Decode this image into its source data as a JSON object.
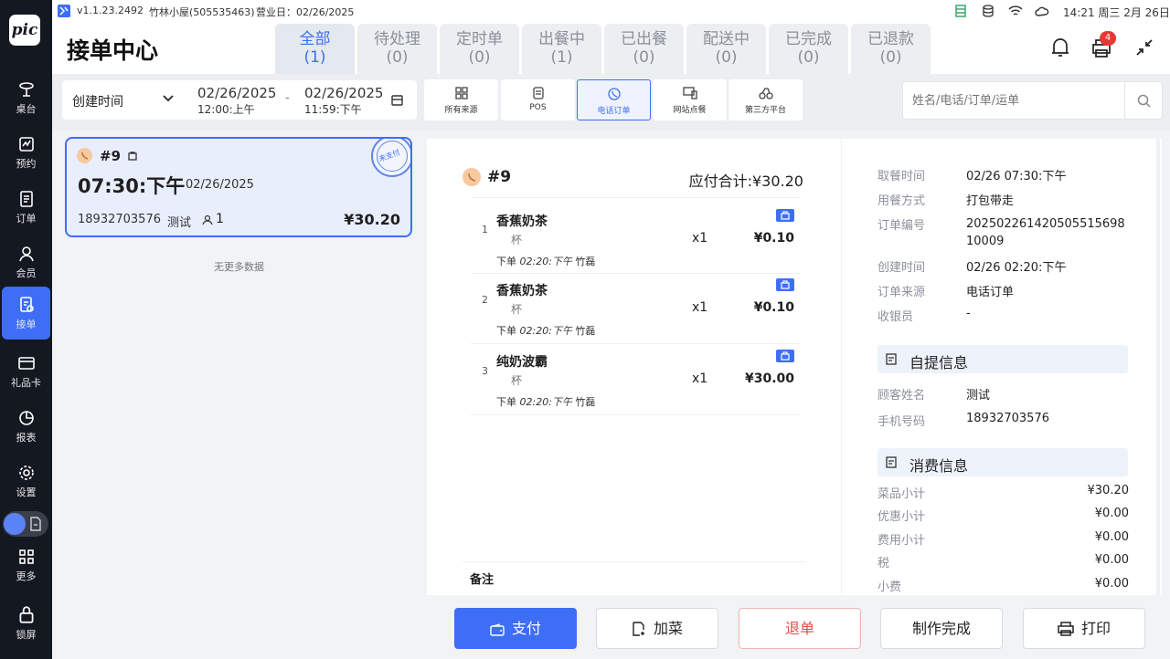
{
  "status": {
    "version": "v1.1.23.2492",
    "store": "竹林小屋(505535463)",
    "business_day": "营业日：02/26/2025",
    "clock": "14:21 周三 2月 26日"
  },
  "sidebar": {
    "logo": "pic",
    "items": [
      {
        "label": "桌台",
        "icon": "table-bell-icon"
      },
      {
        "label": "预约",
        "icon": "calendar-check-icon"
      },
      {
        "label": "订单",
        "icon": "order-list-icon"
      },
      {
        "label": "会员",
        "icon": "user-icon"
      },
      {
        "label": "接单",
        "icon": "receive-order-icon"
      },
      {
        "label": "礼品卡",
        "icon": "gift-card-icon"
      },
      {
        "label": "报表",
        "icon": "pie-chart-icon"
      },
      {
        "label": "设置",
        "icon": "gear-icon"
      },
      {
        "label": "更多",
        "icon": "grid-icon"
      },
      {
        "label": "锁屏",
        "icon": "lock-icon"
      }
    ]
  },
  "header": {
    "title": "接单中心",
    "tabs": [
      {
        "label": "全部",
        "count": "(1)"
      },
      {
        "label": "待处理",
        "count": "(0)"
      },
      {
        "label": "定时单",
        "count": "(0)"
      },
      {
        "label": "出餐中",
        "count": "(1)"
      },
      {
        "label": "已出餐",
        "count": "(0)"
      },
      {
        "label": "配送中",
        "count": "(0)"
      },
      {
        "label": "已完成",
        "count": "(0)"
      },
      {
        "label": "已退款",
        "count": "(0)"
      }
    ],
    "printer_badge": "4"
  },
  "filter": {
    "sort_label": "创建时间",
    "start_date": "02/26/2025",
    "start_time": "12:00:上午",
    "separator": "-",
    "end_date": "02/26/2025",
    "end_time": "11:59:下午",
    "sources": [
      "所有来源",
      "POS",
      "电话订单",
      "网站点餐",
      "第三方平台"
    ],
    "search_placeholder": "姓名/电话/订单/运单"
  },
  "order_card": {
    "number": "#9",
    "time": "07:30:下午",
    "date": "02/26/2025",
    "stamp": "未支付",
    "phone": "18932703576",
    "customer": "测试",
    "guests": "1",
    "total": "¥30.20"
  },
  "list_footer": "无更多数据",
  "detail": {
    "number": "#9",
    "total_label": "应付合计:¥30.20",
    "items": [
      {
        "idx": "1",
        "name": "香蕉奶茶",
        "unit": "杯",
        "qty": "x1",
        "price": "¥0.10",
        "meta_label": "下单",
        "meta_time": "02:20:下午",
        "meta_staff": "竹磊"
      },
      {
        "idx": "2",
        "name": "香蕉奶茶",
        "unit": "杯",
        "qty": "x1",
        "price": "¥0.10",
        "meta_label": "下单",
        "meta_time": "02:20:下午",
        "meta_staff": "竹磊"
      },
      {
        "idx": "3",
        "name": "纯奶波霸",
        "unit": "杯",
        "qty": "x1",
        "price": "¥30.00",
        "meta_label": "下单",
        "meta_time": "02:20:下午",
        "meta_staff": "竹磊"
      }
    ],
    "remark_label": "备注"
  },
  "info": {
    "rows": [
      {
        "label": "取餐时间",
        "value": "02/26 07:30:下午"
      },
      {
        "label": "用餐方式",
        "value": "打包带走"
      },
      {
        "label": "订单编号",
        "value": "20250226142050551569810009"
      },
      {
        "label": "创建时间",
        "value": "02/26 02:20:下午"
      },
      {
        "label": "订单来源",
        "value": "电话订单"
      },
      {
        "label": "收银员",
        "value": "-"
      }
    ],
    "pickup_title": "自提信息",
    "pickup": [
      {
        "label": "顾客姓名",
        "value": "测试"
      },
      {
        "label": "手机号码",
        "value": "18932703576"
      }
    ],
    "consume_title": "消费信息",
    "consume": [
      {
        "label": "菜品小计",
        "value": "¥30.20"
      },
      {
        "label": "优惠小计",
        "value": "¥0.00"
      },
      {
        "label": "费用小计",
        "value": "¥0.00"
      },
      {
        "label": "税",
        "value": "¥0.00"
      },
      {
        "label": "小费",
        "value": "¥0.00"
      }
    ]
  },
  "actions": {
    "pay": "支付",
    "add": "加菜",
    "refund": "退单",
    "done": "制作完成",
    "print": "打印"
  },
  "colors": {
    "accent": "#3d6ef5",
    "sidebar": "#141821",
    "danger": "#e34a4a"
  }
}
